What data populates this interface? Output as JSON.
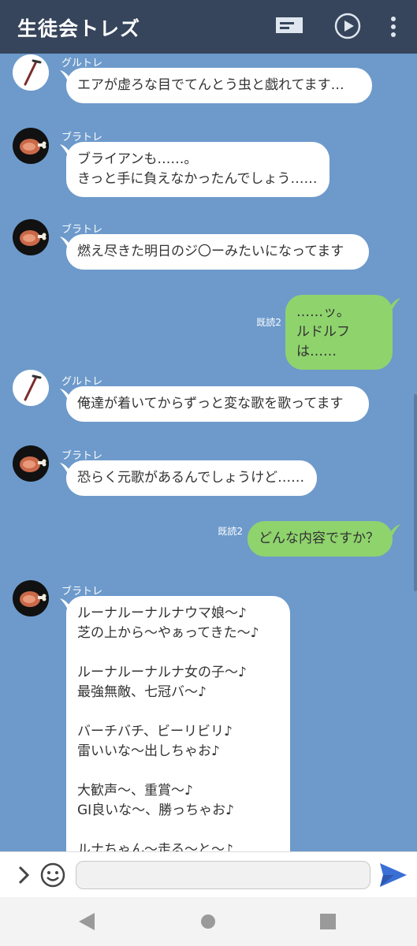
{
  "header": {
    "title": "生徒会トレズ"
  },
  "messages": [
    {
      "sender": "グルトレ",
      "text": "エアが虚ろな目でてんとう虫と戯れてます…"
    },
    {
      "sender": "ブラトレ",
      "text": "ブライアンも……。\nきっと手に負えなかったんでしょう……"
    },
    {
      "sender": "ブラトレ",
      "text": "燃え尽きた明日のジ〇ーみたいになってます"
    },
    {
      "read": "既読2",
      "text": "……ッ。\nルドルフは……"
    },
    {
      "sender": "グルトレ",
      "text": "俺達が着いてからずっと変な歌を歌ってます"
    },
    {
      "sender": "ブラトレ",
      "text": "恐らく元歌があるんでしょうけど……"
    },
    {
      "read": "既読2",
      "text": "どんな内容ですか？"
    },
    {
      "sender": "ブラトレ",
      "text": "ルーナルーナルナウマ娘〜♪\n芝の上から〜やぁってきた〜♪\n\nルーナルーナルナ女の子〜♪\n最強無敵、七冠バ〜♪\n\nバーチバチ、ビーリビリ♪\n雷いいな〜出しちゃお♪\n\n大歓声〜、重賞〜♪\nGI良いな〜、勝っちゃお♪\n\nルナちゃん〜走る〜と〜♪\nみんなが〜喜ぶよ〜♪"
    }
  ],
  "input": {
    "value": ""
  },
  "icons": {
    "menu": "menu-icon",
    "play": "play-icon",
    "more": "more-vert-icon",
    "expand": "chevron-right-icon",
    "emoji": "emoji-icon",
    "send": "send-icon",
    "back": "back-icon",
    "home": "home-icon",
    "recents": "recents-icon"
  },
  "colors": {
    "header_bg": "#36455b",
    "chat_bg": "#6d9acb",
    "incoming_bubble": "#ffffff",
    "outgoing_bubble": "#8fd36d",
    "send": "#3a6fd6"
  }
}
